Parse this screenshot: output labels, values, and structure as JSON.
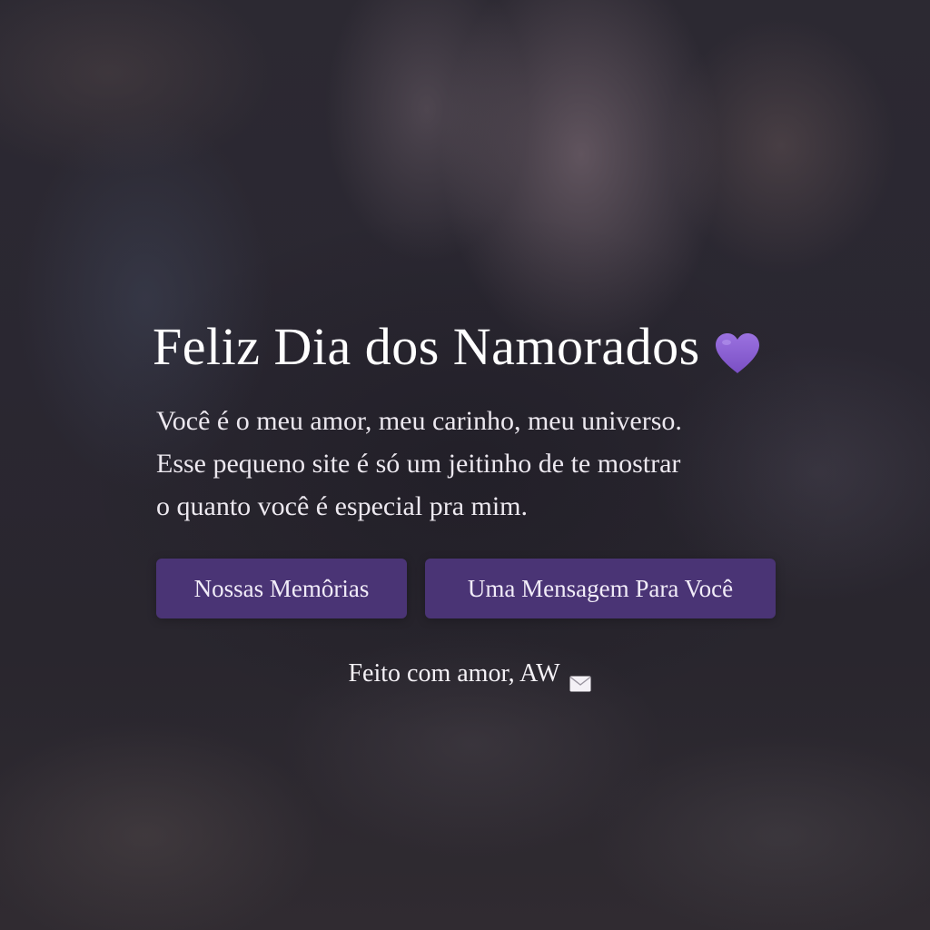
{
  "page": {
    "title": "Feliz Dia dos Namorados",
    "title_icon": "purple-heart-icon",
    "message_lines": [
      "Você é o meu amor, meu carinho, meu universo.",
      "Esse pequeno site é só um jeitinho de te mostrar",
      "o quanto você é especial pra mim."
    ],
    "buttons": {
      "memories_label": "Nossas Memôrias",
      "message_label": "Uma Mensagem Para Você"
    },
    "footer": {
      "text": "Feito com amor, AW",
      "icon": "envelope-icon"
    }
  },
  "colors": {
    "button_background": "#4a3475",
    "heart": "#8a5fd0",
    "text": "#ffffff"
  }
}
